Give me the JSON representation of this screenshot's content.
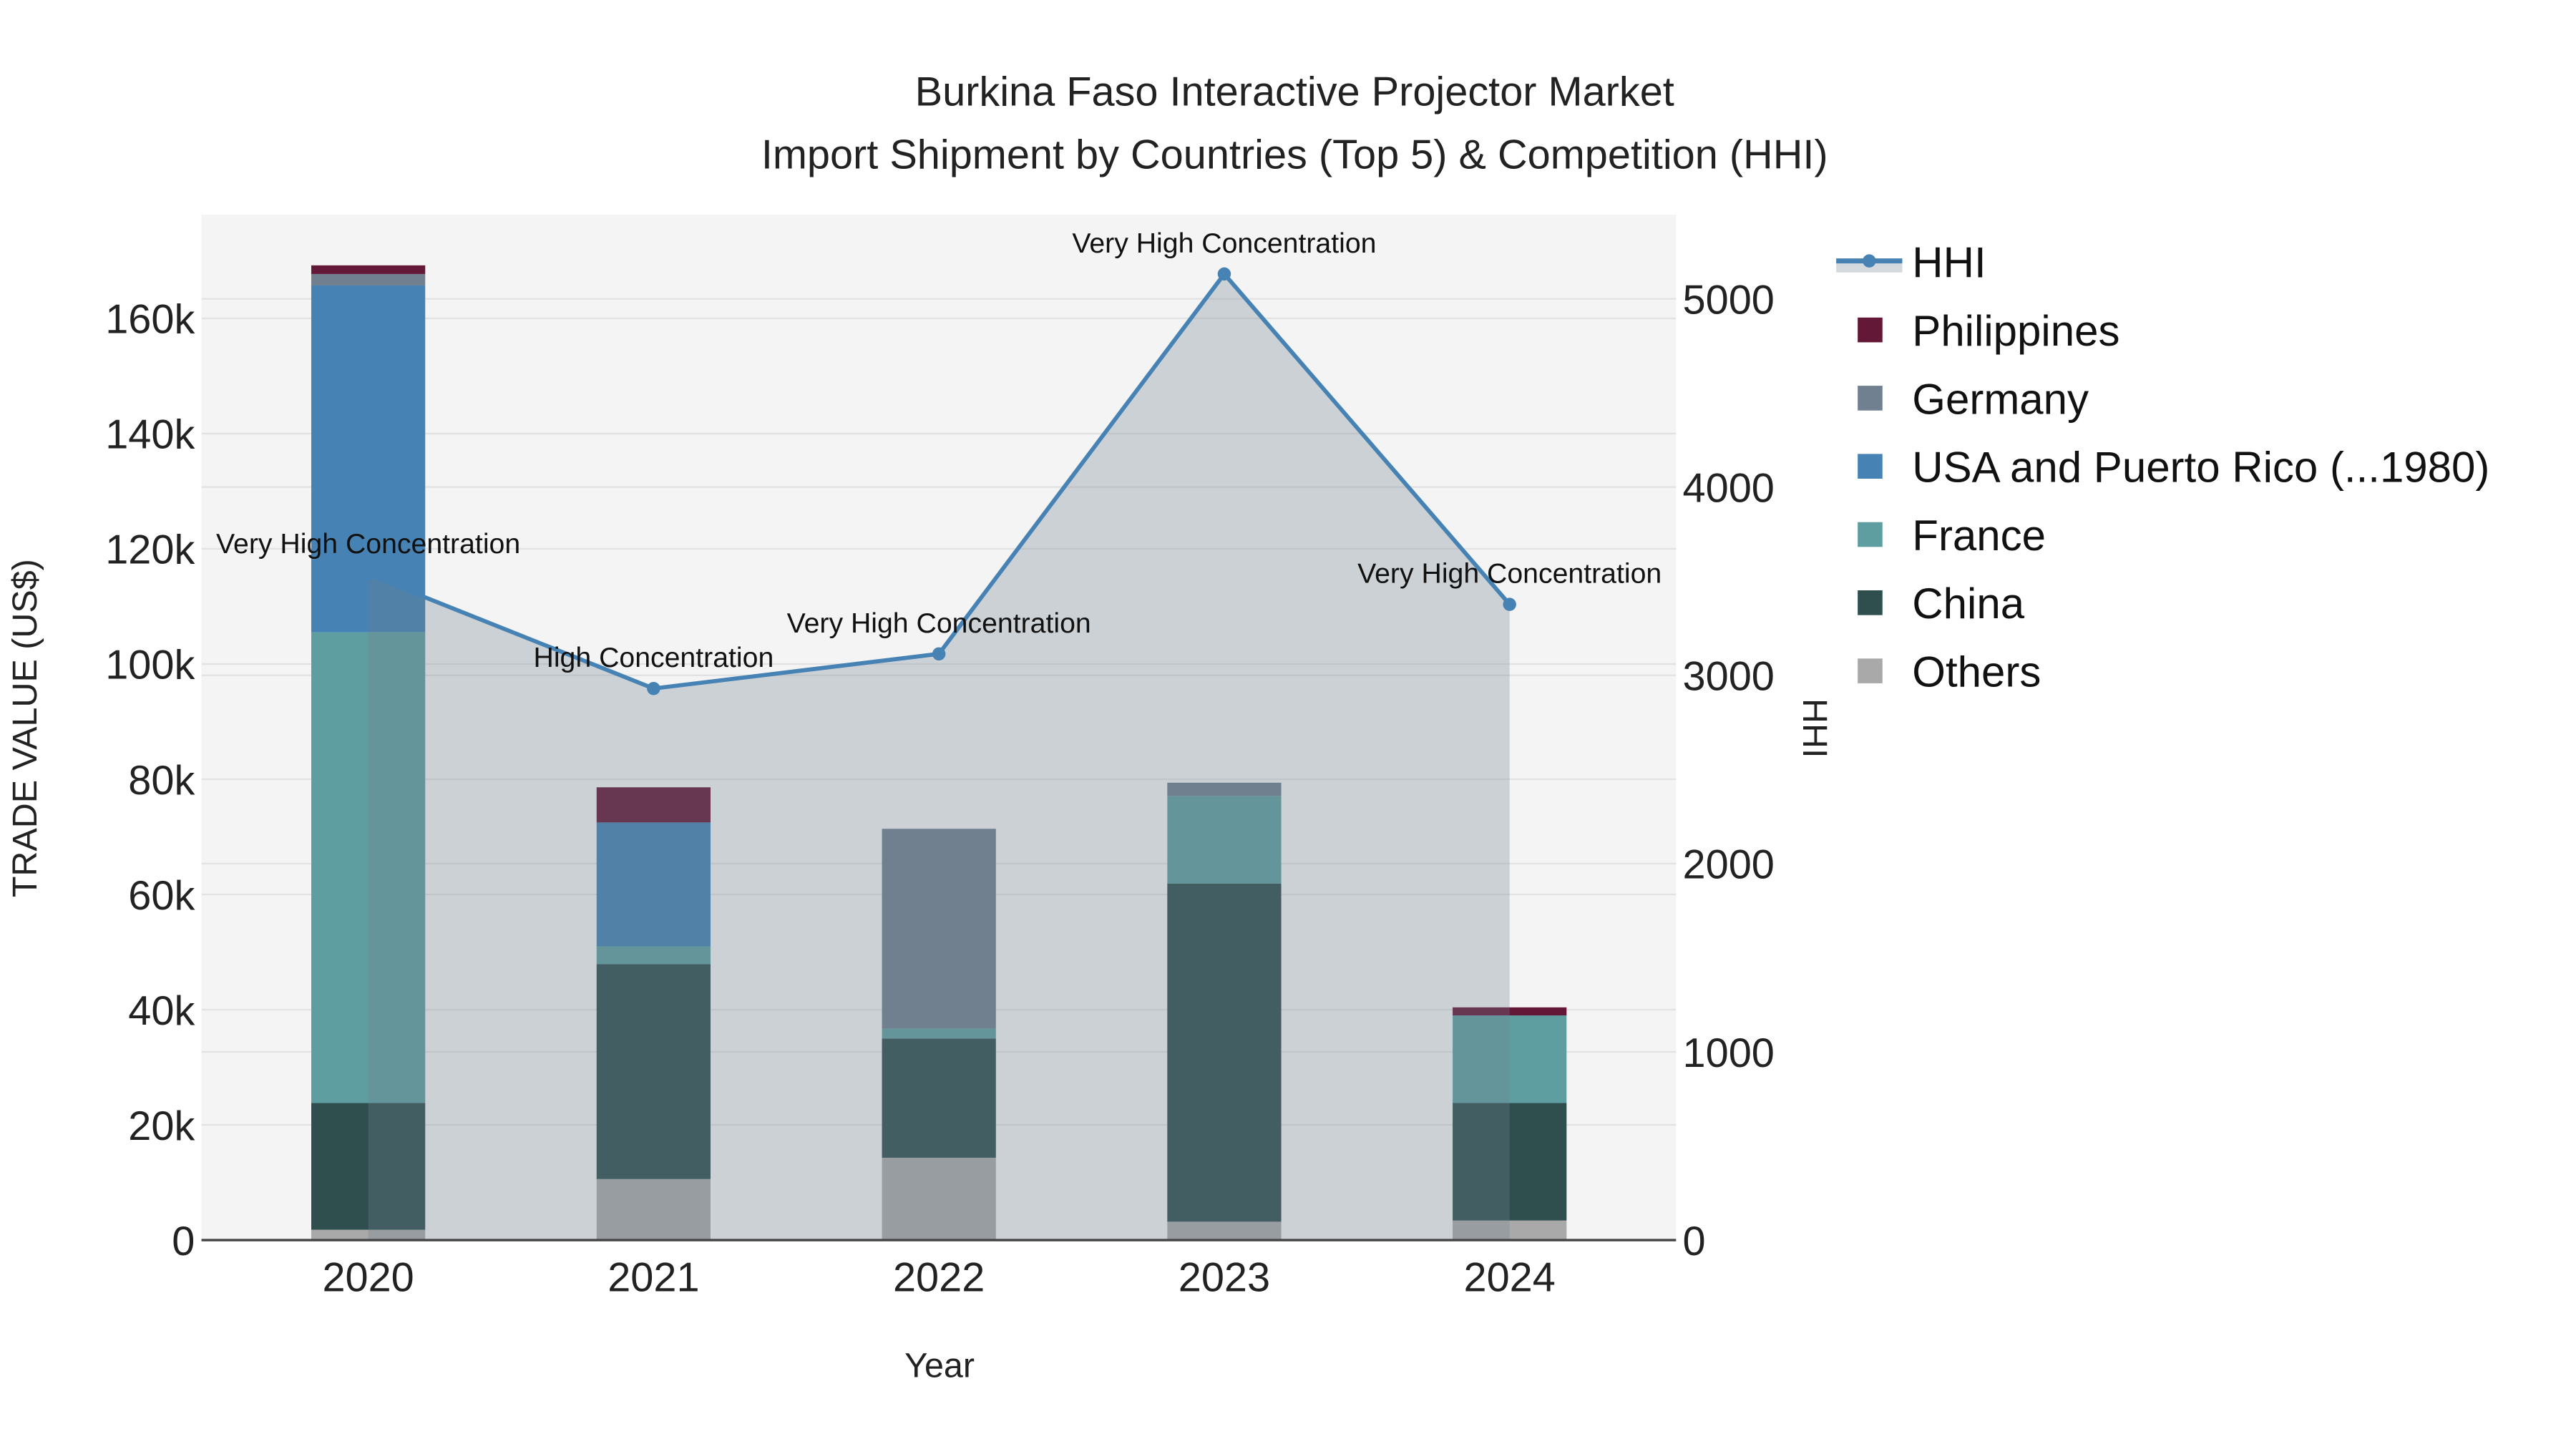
{
  "chart_data": {
    "type": "bar",
    "stacked": true,
    "title": "Burkina Faso Interactive Projector Market",
    "subtitle": "Import Shipment by Countries (Top 5) & Competition (HHI)",
    "xlabel": "Year",
    "ylabel": "TRADE VALUE (US$)",
    "y2label": "HHI",
    "categories": [
      "2020",
      "2021",
      "2022",
      "2023",
      "2024"
    ],
    "ylim": [
      0,
      178000
    ],
    "y2lim": [
      0,
      5447
    ],
    "yticks": [
      0,
      20000,
      40000,
      60000,
      80000,
      100000,
      120000,
      140000,
      160000
    ],
    "ytick_labels": [
      "0",
      "20k",
      "40k",
      "60k",
      "80k",
      "100k",
      "120k",
      "140k",
      "160k"
    ],
    "y2ticks": [
      0,
      1000,
      2000,
      3000,
      4000,
      5000
    ],
    "y2tick_labels": [
      "0",
      "1000",
      "2000",
      "3000",
      "4000",
      "5000"
    ],
    "grid": true,
    "legend_position": "right",
    "series": [
      {
        "name": "Others",
        "color": "#a9a9a9",
        "values": [
          1800,
          10600,
          14300,
          3200,
          3400
        ]
      },
      {
        "name": "China",
        "color": "#2f4f4f",
        "values": [
          22000,
          37300,
          20700,
          58700,
          20400
        ]
      },
      {
        "name": "France",
        "color": "#5f9ea0",
        "values": [
          81700,
          3100,
          1700,
          15200,
          15200
        ]
      },
      {
        "name": "USA and Puerto Rico (...1980)",
        "color": "#4682b4",
        "values": [
          60200,
          21500,
          0,
          0,
          0
        ]
      },
      {
        "name": "Germany",
        "color": "#708090",
        "values": [
          2000,
          0,
          34700,
          2300,
          0
        ]
      },
      {
        "name": "Philippines",
        "color": "#631837",
        "values": [
          1500,
          6100,
          0,
          0,
          1400
        ]
      }
    ],
    "hhi": {
      "name": "HHI",
      "color": "#4682b4",
      "values": [
        3535,
        2930,
        3114,
        5132,
        3377
      ],
      "labels": [
        "Very High Concentration",
        "High Concentration",
        "Very High Concentration",
        "Very High Concentration",
        "Very High Concentration"
      ]
    },
    "legend_order": [
      "HHI",
      "Philippines",
      "Germany",
      "USA and Puerto Rico (...1980)",
      "France",
      "China",
      "Others"
    ]
  }
}
